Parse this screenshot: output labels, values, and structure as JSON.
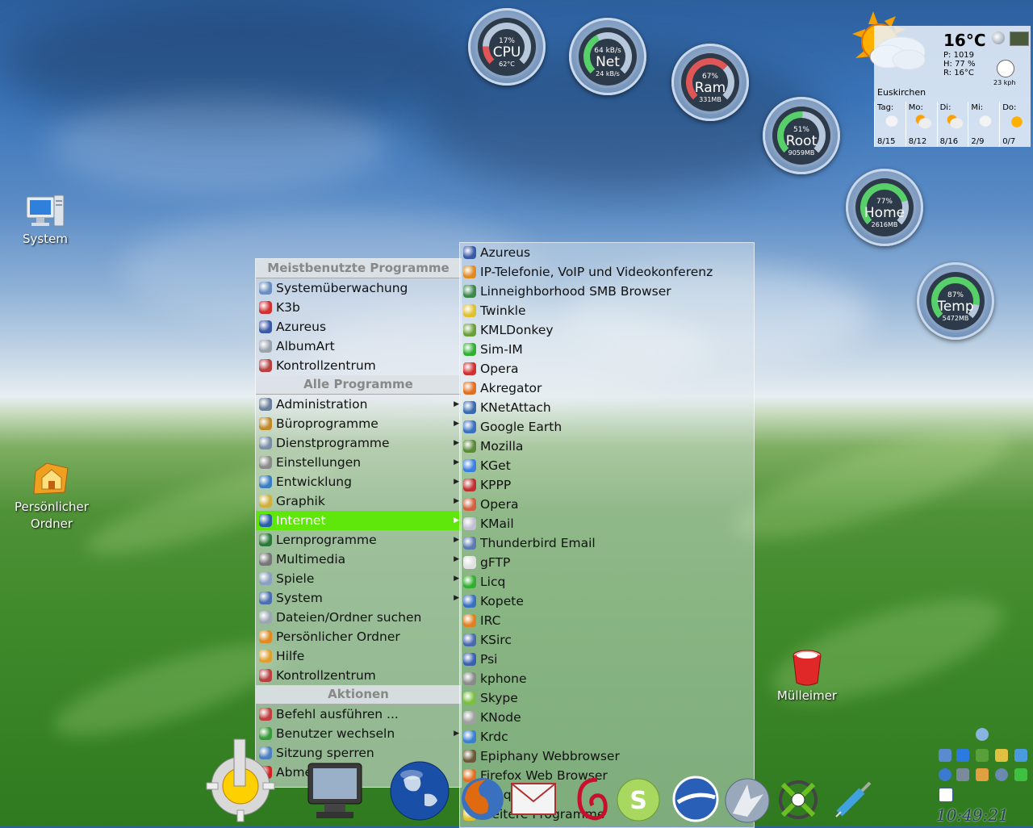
{
  "desktop": {
    "icons": [
      {
        "label": "System",
        "icon": "computer-icon"
      },
      {
        "label": "Persönlicher Ordner",
        "icon": "home-folder-icon"
      },
      {
        "label": "Mülleimer",
        "icon": "trash-icon"
      }
    ]
  },
  "gauges": [
    {
      "name": "CPU",
      "percent": "17%",
      "sub": "62°C",
      "value": 17,
      "color": "#e05555"
    },
    {
      "name": "Net",
      "percent": "64 kB/s",
      "sub": "24 kB/s",
      "value": 40,
      "color": "#58d06a"
    },
    {
      "name": "Ram",
      "percent": "67%",
      "sub": "331MB",
      "value": 67,
      "color": "#e05555"
    },
    {
      "name": "Root",
      "percent": "51%",
      "sub": "9059MB",
      "value": 51,
      "color": "#58d06a"
    },
    {
      "name": "Home",
      "percent": "77%",
      "sub": "2616MB",
      "value": 77,
      "color": "#58d06a"
    },
    {
      "name": "Temp",
      "percent": "87%",
      "sub": "5472MB",
      "value": 87,
      "color": "#58d06a"
    }
  ],
  "weather": {
    "temperature": "16°C",
    "pressure": "P: 1019",
    "humidity": "H: 77 %",
    "realfeel": "R: 16°C",
    "wind": "23 kph",
    "city": "Euskirchen",
    "days": [
      {
        "name": "Tag:",
        "range": "8/15",
        "icon": "snow-cloud-icon"
      },
      {
        "name": "Mo:",
        "range": "8/12",
        "icon": "cloudy-sun-icon"
      },
      {
        "name": "Di:",
        "range": "8/16",
        "icon": "cloudy-sun-icon"
      },
      {
        "name": "Mi:",
        "range": "2/9",
        "icon": "snow-cloud-icon"
      },
      {
        "name": "Do:",
        "range": "0/7",
        "icon": "sun-icon"
      }
    ]
  },
  "menu": {
    "header_most_used": "Meistbenutzte Programme",
    "most_used": [
      {
        "label": "Systemüberwachung",
        "icon": "monitor-icon",
        "color": "#6a8fbf"
      },
      {
        "label": "K3b",
        "icon": "k3b-icon",
        "color": "#d03030"
      },
      {
        "label": "Azureus",
        "icon": "azureus-icon",
        "color": "#3a5aa8"
      },
      {
        "label": "AlbumArt",
        "icon": "albumart-icon",
        "color": "#9aa3ad"
      },
      {
        "label": "Kontrollzentrum",
        "icon": "control-center-icon",
        "color": "#b84040"
      }
    ],
    "header_all": "Alle Programme",
    "all": [
      {
        "label": "Administration",
        "icon": "admin-icon",
        "color": "#6a7f99",
        "sub": true
      },
      {
        "label": "Büroprogramme",
        "icon": "office-icon",
        "color": "#c08a2a",
        "sub": true
      },
      {
        "label": "Dienstprogramme",
        "icon": "utilities-icon",
        "color": "#7a8fa6",
        "sub": true
      },
      {
        "label": "Einstellungen",
        "icon": "settings-icon",
        "color": "#8a8a8a",
        "sub": true
      },
      {
        "label": "Entwicklung",
        "icon": "development-icon",
        "color": "#3a7fc0",
        "sub": true
      },
      {
        "label": "Graphik",
        "icon": "graphics-icon",
        "color": "#d0b040",
        "sub": true
      },
      {
        "label": "Internet",
        "icon": "internet-icon",
        "color": "#2a5fa8",
        "sub": true,
        "active": true
      },
      {
        "label": "Lernprogramme",
        "icon": "edu-icon",
        "color": "#2a7a3a",
        "sub": true
      },
      {
        "label": "Multimedia",
        "icon": "multimedia-icon",
        "color": "#777777",
        "sub": true
      },
      {
        "label": "Spiele",
        "icon": "games-icon",
        "color": "#8aa0c0",
        "sub": true
      },
      {
        "label": "System",
        "icon": "system-icon",
        "color": "#4a6fb0",
        "sub": true
      },
      {
        "label": "Dateien/Ordner suchen",
        "icon": "find-icon",
        "color": "#9aa6b2",
        "sub": false
      },
      {
        "label": "Persönlicher Ordner",
        "icon": "home-icon",
        "color": "#e08a20",
        "sub": false
      },
      {
        "label": "Hilfe",
        "icon": "help-icon",
        "color": "#e0a030",
        "sub": false
      },
      {
        "label": "Kontrollzentrum",
        "icon": "control-center-icon",
        "color": "#b84040",
        "sub": false
      }
    ],
    "header_actions": "Aktionen",
    "actions": [
      {
        "label": "Befehl ausführen ...",
        "icon": "run-icon",
        "color": "#c04040",
        "sub": false
      },
      {
        "label": "Benutzer wechseln",
        "icon": "switch-user-icon",
        "color": "#3a9a3a",
        "sub": true
      },
      {
        "label": "Sitzung sperren",
        "icon": "lock-icon",
        "color": "#4a7fc0",
        "sub": false
      },
      {
        "label": "Abmelden ...",
        "icon": "logout-icon",
        "color": "#d02020",
        "sub": false
      }
    ]
  },
  "submenu": {
    "items": [
      {
        "label": "Azureus",
        "icon": "azureus-icon",
        "color": "#3a5aa8"
      },
      {
        "label": "IP-Telefonie, VoIP und Videokonferenz",
        "icon": "voip-icon",
        "color": "#e08a20"
      },
      {
        "label": "Linneighborhood SMB Browser",
        "icon": "smb-icon",
        "color": "#3a8a4a"
      },
      {
        "label": "Twinkle",
        "icon": "twinkle-icon",
        "color": "#e0c030"
      },
      {
        "label": "KMLDonkey",
        "icon": "donkey-icon",
        "color": "#6aa03a"
      },
      {
        "label": "Sim-IM",
        "icon": "sim-icon",
        "color": "#30b030"
      },
      {
        "label": "Opera",
        "icon": "opera-icon",
        "color": "#d03030"
      },
      {
        "label": "Akregator",
        "icon": "rss-icon",
        "color": "#e07020"
      },
      {
        "label": "KNetAttach",
        "icon": "netattach-icon",
        "color": "#3a6ab0"
      },
      {
        "label": "Google Earth",
        "icon": "google-earth-icon",
        "color": "#3a70c0"
      },
      {
        "label": "Mozilla",
        "icon": "mozilla-icon",
        "color": "#5a8a3a"
      },
      {
        "label": "KGet",
        "icon": "kget-icon",
        "color": "#3a80e0"
      },
      {
        "label": "KPPP",
        "icon": "kppp-icon",
        "color": "#c03030"
      },
      {
        "label": "Opera",
        "icon": "opera-icon",
        "color": "#d06040"
      },
      {
        "label": "KMail",
        "icon": "kmail-icon",
        "color": "#c0c0d0"
      },
      {
        "label": "Thunderbird Email",
        "icon": "thunderbird-icon",
        "color": "#5a7ab0"
      },
      {
        "label": "gFTP",
        "icon": "gftp-icon",
        "color": "#e0e0e0"
      },
      {
        "label": "Licq",
        "icon": "licq-icon",
        "color": "#30b030"
      },
      {
        "label": "Kopete",
        "icon": "kopete-icon",
        "color": "#3a70c0"
      },
      {
        "label": "IRC",
        "icon": "irc-icon",
        "color": "#e08020"
      },
      {
        "label": "KSirc",
        "icon": "ksirc-icon",
        "color": "#4a6ab0"
      },
      {
        "label": "Psi",
        "icon": "psi-icon",
        "color": "#3a60b0"
      },
      {
        "label": "kphone",
        "icon": "kphone-icon",
        "color": "#8a8a8a"
      },
      {
        "label": "Skype",
        "icon": "skype-icon",
        "color": "#7ac040"
      },
      {
        "label": "KNode",
        "icon": "knode-icon",
        "color": "#a0a0a0"
      },
      {
        "label": "Krdc",
        "icon": "krdc-icon",
        "color": "#3a80d0"
      },
      {
        "label": "Epiphany Webbrowser",
        "icon": "epiphany-icon",
        "color": "#6a5a3a"
      },
      {
        "label": "Firefox Web Browser",
        "icon": "firefox-icon",
        "color": "#e07020"
      },
      {
        "label": "Konqueror",
        "icon": "konqueror-icon",
        "color": "#3a60b0"
      },
      {
        "label": "Weitere Programme",
        "icon": "more-icon",
        "color": "#e0c030",
        "sub": true
      }
    ]
  },
  "dock": [
    {
      "name": "kde-menu-icon"
    },
    {
      "name": "display-settings-icon"
    },
    {
      "name": "globe-icon"
    },
    {
      "name": "firefox-dock-icon"
    },
    {
      "name": "mail-dock-icon"
    },
    {
      "name": "debian-dock-icon"
    },
    {
      "name": "skype-dock-icon"
    },
    {
      "name": "google-earth-dock-icon"
    },
    {
      "name": "konqueror-dock-icon"
    },
    {
      "name": "amarok-dock-icon"
    },
    {
      "name": "syringe-dock-icon"
    }
  ],
  "clock": {
    "time": "10:49:21"
  }
}
